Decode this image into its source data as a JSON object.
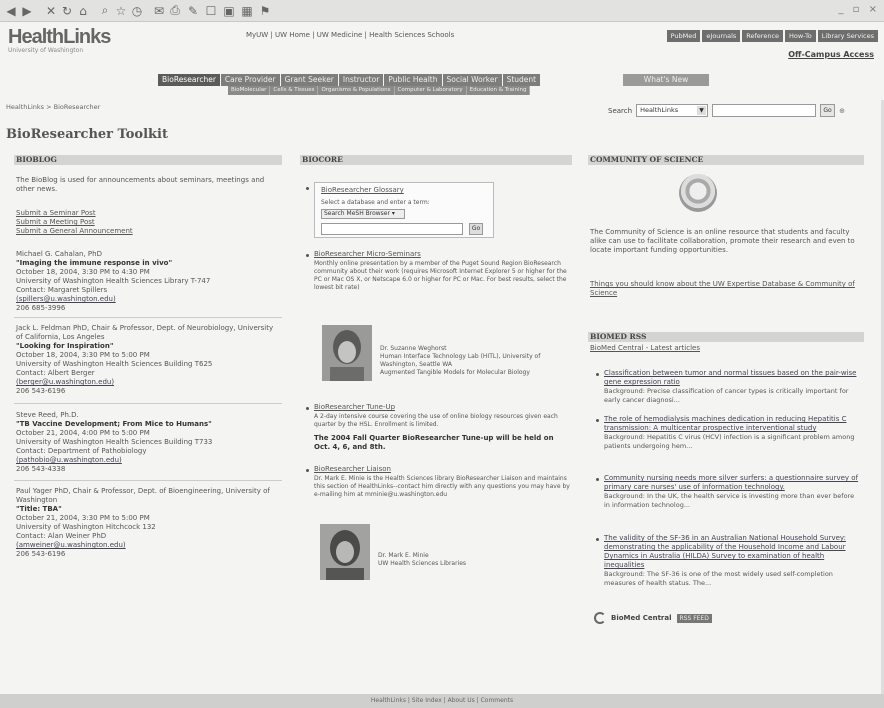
{
  "header": {
    "logo_text": "HealthLinks",
    "logo_sub": "University of Washington",
    "top_links": "MyUW | UW Home | UW Medicine | Health Sciences Schools",
    "top_nav": [
      "PubMed",
      "eJournals",
      "Reference",
      "How-To",
      "Library Services"
    ],
    "off_campus": "Off-Campus Access",
    "role_tabs": [
      "BioResearcher",
      "Care Provider",
      "Grant Seeker",
      "Instructor",
      "Public Health",
      "Social Worker",
      "Student"
    ],
    "whats_new": "What's New",
    "sub_tabs": [
      "BioMolecular",
      "Cells & Tissues",
      "Organisms & Populations",
      "Computer & Laboratory",
      "Education & Training"
    ]
  },
  "breadcrumb": "HealthLinks > BioResearcher",
  "search": {
    "label": "Search",
    "scope": "HealthLinks",
    "go": "Go"
  },
  "page_title": "BioResearcher Toolkit",
  "bioblog": {
    "heading": "BIOBLOG",
    "intro": "The BioBlog is used for announcements about seminars, meetings and other news.",
    "links": [
      "Submit a Seminar Post",
      "Submit a Meeting Post",
      "Submit a General Announcement"
    ],
    "entries": [
      {
        "speaker": "Michael G. Cahalan, PhD",
        "title": "\"Imaging the immune response in vivo\"",
        "date": "October 18, 2004, 3:30 PM to 4:30 PM",
        "location": "University of Washington Health Sciences Library T-747",
        "contact": "Contact: Margaret Spillers",
        "email": "(spillers@u.washington.edu)",
        "phone": "206 685-3996"
      },
      {
        "speaker": "Jack L. Feldman PhD, Chair & Professor, Dept. of Neurobiology, University of California, Los Angeles",
        "title": "\"Looking for Inspiration\"",
        "date": "October 18, 2004, 3:30 PM to 5:00 PM",
        "location": "University of Washington Health Sciences Building T625",
        "contact": "Contact: Albert Berger",
        "email": "(berger@u.washington.edu)",
        "phone": "206 543-6196"
      },
      {
        "speaker": "Steve Reed, Ph.D.",
        "title": "\"TB Vaccine Development; From Mice to Humans\"",
        "date": "October 21, 2004, 4:00 PM to 5:00 PM",
        "location": "University of Washington Health Sciences Building T733",
        "contact": "Contact: Department of Pathobiology",
        "email": "(pathobio@u.washington.edu)",
        "phone": "206 543-4338"
      },
      {
        "speaker": "Paul Yager PhD, Chair & Professor, Dept. of Bioengineering, University of Washington",
        "title": "\"Title: TBA\"",
        "date": "October 21, 2004, 3:30 PM to 5:00 PM",
        "location": "University of Washington Hitchcock 132",
        "contact": "Contact: Alan Weiner PhD",
        "email": "(amweiner@u.washington.edu)",
        "phone": "206 543-6196"
      }
    ]
  },
  "biocore": {
    "heading": "BIOCORE",
    "glossary_title": "BioResearcher Glossary",
    "glossary_desc": "Select a database and enter a term:",
    "glossary_select": "Search MeSH Browser",
    "glossary_go": "Go",
    "microseminars_title": "BioResearcher Micro-Seminars",
    "microseminars_desc": "Monthly online presentation by a member of the Puget Sound Region BioResearch community about their work (requires Microsoft Internet Explorer 5 or higher for the PC or Mac OS X, or Netscape 6.0 or higher for PC or Mac. For best results, select the lowest bit rate)",
    "presenter1": "Dr. Suzanne Weghorst",
    "presenter1_org": "Human Interface Technology Lab (HITL), University of Washington, Seattle WA",
    "presenter1_topic": "Augmented Tangible Models for Molecular Biology",
    "tuneup_title": "BioResearcher Tune-Up",
    "tuneup_desc": "A 2-day intensive course covering the use of online biology resources given each quarter by the HSL. Enrollment is limited.",
    "tuneup_notice": "The 2004 Fall Quarter BioResearcher Tune-up will be held on Oct. 4, 6, and 8th.",
    "liaison_title": "BioResearcher Liaison",
    "liaison_desc": "Dr. Mark E. Minie is the Health Sciences library BioResearcher Liaison and maintains this section of HealthLinks--contact him directly with any questions you may have by e-mailing him at mminie@u.washington.edu",
    "presenter2": "Dr. Mark E. Minie",
    "presenter2_org": "UW Health Sciences Libraries"
  },
  "community": {
    "heading": "COMMUNITY OF SCIENCE",
    "desc": "The Community of Science is an online resource that students and faculty alike can use to facilitate collaboration, promote their research and even to locate important funding opportunities.",
    "link": "Things you should know about the UW Expertise Database & Community of Science"
  },
  "biomed": {
    "heading": "BIOMED RSS",
    "source": "BioMed Central - Latest articles",
    "items": [
      {
        "title": "Classification between tumor and normal tissues based on the pair-wise gene expression ratio",
        "desc": "Background: Precise classification of cancer types is critically important for early cancer diagnosi..."
      },
      {
        "title": "The role of hemodialysis machines dedication in reducing Hepatitis C transmission: A multicentar prospective interventional study",
        "desc": "Background: Hepatitis C virus (HCV) infection is a significant problem among patients undergoing hem..."
      },
      {
        "title": "Community nursing needs more silver surfers: a questionnaire survey of primary care nurses' use of information technology.",
        "desc": "Background: In the UK, the health service is investing more than ever before in information technolog..."
      },
      {
        "title": "The validity of the SF-36 in an Australian National Household Survey: demonstrating the applicability of the Household Income and Labour Dynamics in Australia (HILDA) Survey to examination of health inequalities",
        "desc": "Background: The SF-36 is one of the most widely used self-completion measures of health status. The..."
      }
    ],
    "footer_logo": "BioMed Central",
    "footer_badge": "RSS FEED"
  },
  "footer": "HealthLinks | Site Index | About Us | Comments"
}
